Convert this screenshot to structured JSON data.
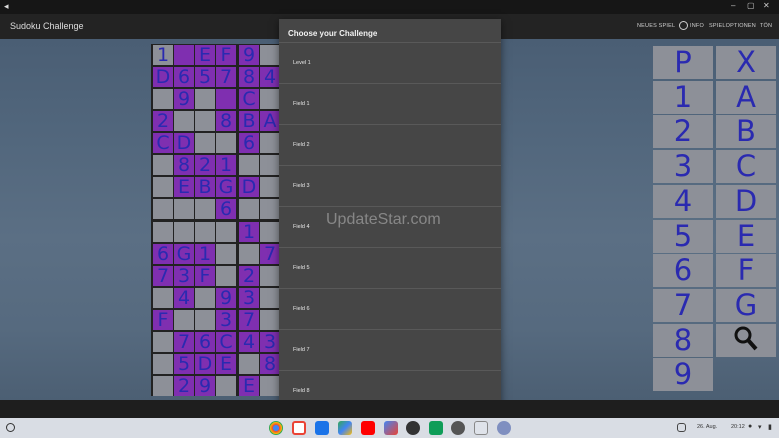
{
  "window": {
    "back_glyph": "◂",
    "min_glyph": "–",
    "max_glyph": "▢",
    "close_glyph": "✕"
  },
  "app": {
    "title": "Sudoku Challenge"
  },
  "menu": {
    "new_game": "NEUES SPIEL",
    "info": "INFO",
    "options": "SPIELOPTIONEN",
    "sound": "TÖN"
  },
  "grid": {
    "rows": [
      [
        "1",
        "",
        "E",
        "F",
        "9",
        "",
        "",
        "",
        "",
        "",
        "",
        "",
        "",
        "",
        "",
        "",
        "",
        "",
        ""
      ],
      [
        "D",
        "6",
        "5",
        "7",
        "8",
        "4",
        "",
        "",
        "",
        "",
        "",
        "",
        "",
        "",
        "",
        "",
        "",
        "",
        ""
      ],
      [
        "",
        "9",
        "",
        "",
        "C",
        "",
        "",
        "",
        "",
        "",
        "",
        "",
        "",
        "",
        "",
        "",
        "",
        "",
        ""
      ],
      [
        "2",
        "",
        "",
        "8",
        "B",
        "A",
        "",
        "",
        "",
        "",
        "",
        "",
        "",
        "",
        "",
        "",
        "",
        "",
        ""
      ],
      [
        "C",
        "D",
        "",
        "",
        "6",
        "",
        "",
        "",
        "",
        "",
        "",
        "",
        "",
        "",
        "",
        "",
        "",
        "",
        ""
      ],
      [
        "",
        "8",
        "2",
        "1",
        "",
        "",
        "",
        "",
        "",
        "",
        "",
        "",
        "",
        "",
        "",
        "",
        "",
        "",
        ""
      ],
      [
        "",
        "E",
        "B",
        "G",
        "D",
        "",
        "",
        "",
        "",
        "",
        "",
        "",
        "",
        "",
        "",
        "",
        "",
        "",
        ""
      ],
      [
        "",
        "",
        "",
        "6",
        "",
        "",
        "",
        "",
        "",
        "",
        "",
        "",
        "",
        "",
        "",
        "",
        "",
        "",
        ""
      ],
      [
        "",
        "",
        "",
        "",
        "1",
        "",
        "",
        "",
        "",
        "",
        "",
        "",
        "",
        "",
        "",
        "",
        "",
        "",
        ""
      ],
      [
        "6",
        "G",
        "1",
        "",
        "",
        "7",
        "",
        "",
        "",
        "",
        "",
        "",
        "",
        "",
        "",
        "",
        "",
        "",
        ""
      ],
      [
        "7",
        "3",
        "F",
        "",
        "2",
        "",
        "",
        "",
        "",
        "",
        "",
        "",
        "",
        "",
        "",
        "",
        "",
        "",
        ""
      ],
      [
        "",
        "4",
        "",
        "9",
        "3",
        "",
        "",
        "",
        "",
        "",
        "",
        "",
        "",
        "",
        "",
        "",
        "",
        "",
        ""
      ],
      [
        "F",
        "",
        "",
        "3",
        "7",
        "",
        "",
        "",
        "",
        "",
        "",
        "",
        "",
        "",
        "",
        "",
        "",
        "",
        ""
      ],
      [
        "",
        "7",
        "6",
        "C",
        "4",
        "3",
        "",
        "",
        "",
        "",
        "",
        "",
        "",
        "",
        "",
        "",
        "",
        "",
        ""
      ],
      [
        "",
        "5",
        "D",
        "E",
        "",
        "8",
        "",
        "",
        "",
        "",
        "",
        "",
        "",
        "",
        "",
        "",
        "",
        "",
        ""
      ],
      [
        "",
        "2",
        "9",
        "",
        "E",
        "",
        "",
        "",
        "",
        "",
        "",
        "",
        "",
        "",
        "",
        "",
        "",
        "",
        ""
      ]
    ],
    "filled": [
      [
        0,
        1,
        1,
        1,
        1,
        0
      ],
      [
        1,
        1,
        1,
        1,
        1,
        1
      ],
      [
        0,
        1,
        0,
        1,
        1,
        0
      ],
      [
        1,
        0,
        0,
        1,
        1,
        1
      ],
      [
        1,
        1,
        0,
        0,
        1,
        0
      ],
      [
        0,
        1,
        1,
        1,
        0,
        0
      ],
      [
        0,
        1,
        1,
        1,
        1,
        0
      ],
      [
        0,
        0,
        0,
        1,
        0,
        0
      ],
      [
        0,
        0,
        0,
        0,
        1,
        0
      ],
      [
        1,
        1,
        1,
        0,
        0,
        1
      ],
      [
        1,
        1,
        1,
        0,
        1,
        0
      ],
      [
        0,
        1,
        0,
        1,
        1,
        0
      ],
      [
        1,
        0,
        0,
        1,
        1,
        0
      ],
      [
        0,
        1,
        1,
        1,
        1,
        1
      ],
      [
        0,
        1,
        1,
        1,
        0,
        1
      ],
      [
        0,
        1,
        1,
        0,
        1,
        0
      ]
    ]
  },
  "keypad": {
    "left": [
      "P",
      "1",
      "2",
      "3",
      "4",
      "5",
      "6",
      "7",
      "8",
      "9"
    ],
    "right": [
      "X",
      "A",
      "B",
      "C",
      "D",
      "E",
      "F",
      "G",
      ""
    ],
    "search_icon": "magnifier-icon"
  },
  "dialog": {
    "title": "Choose your Challenge",
    "items": [
      "Level 1",
      "Field 1",
      "Field 2",
      "Field 3",
      "Field 4",
      "Field 5",
      "Field 6",
      "Field 7",
      "Field 8"
    ]
  },
  "watermark": "UpdateStar.com",
  "shelf": {
    "date": "26. Aug.",
    "time": "20:12"
  },
  "colors": {
    "cell_filled": "#7f2fb0",
    "cell_empty": "#8d9098",
    "digit": "#2a2ab0"
  }
}
